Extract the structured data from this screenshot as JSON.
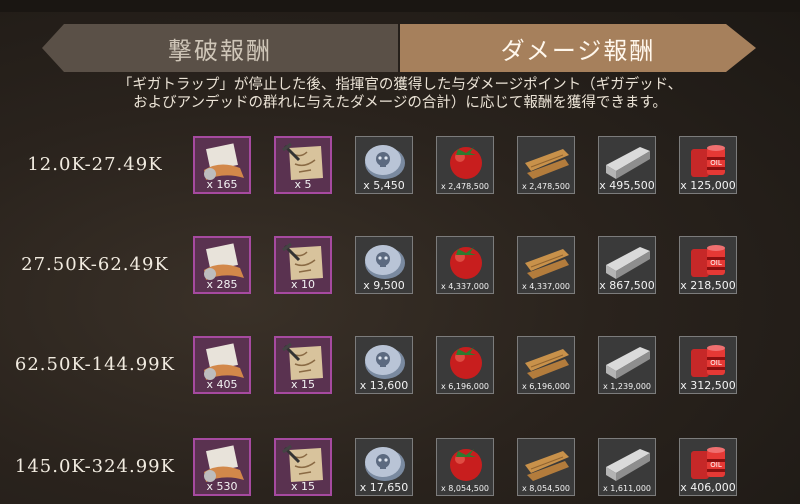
{
  "tabs": {
    "left": "撃破報酬",
    "right": "ダメージ報酬"
  },
  "description": {
    "line1": "「ギガトラップ」が停止した後、指揮官の獲得した与ダメージポイント（ギガデッド、",
    "line2": "およびアンデッドの群れに与えたダメージの合計）に応じて報酬を獲得できます。"
  },
  "reward_rows": [
    {
      "range": "12.0K-27.49K",
      "qty": [
        "x 165",
        "x 5",
        "x 5,450",
        "x 2,478,500",
        "x 2,478,500",
        "x 495,500",
        "x 125,000"
      ]
    },
    {
      "range": "27.50K-62.49K",
      "qty": [
        "x 285",
        "x 10",
        "x 9,500",
        "x 4,337,000",
        "x 4,337,000",
        "x 867,500",
        "x 218,500"
      ]
    },
    {
      "range": "62.50K-144.99K",
      "qty": [
        "x 405",
        "x 15",
        "x 13,600",
        "x 6,196,000",
        "x 6,196,000",
        "x 1,239,000",
        "x 312,500"
      ]
    },
    {
      "range": "145.0K-324.99K",
      "qty": [
        "x 530",
        "x 15",
        "x 17,650",
        "x 8,054,500",
        "x 8,054,500",
        "x 1,611,000",
        "x 406,000"
      ]
    }
  ],
  "item_icons": [
    "blueprint-paper-icon",
    "map-scroll-icon",
    "skull-coin-icon",
    "tomato-icon",
    "wood-plank-icon",
    "steel-beam-icon",
    "fuel-barrel-icon"
  ]
}
